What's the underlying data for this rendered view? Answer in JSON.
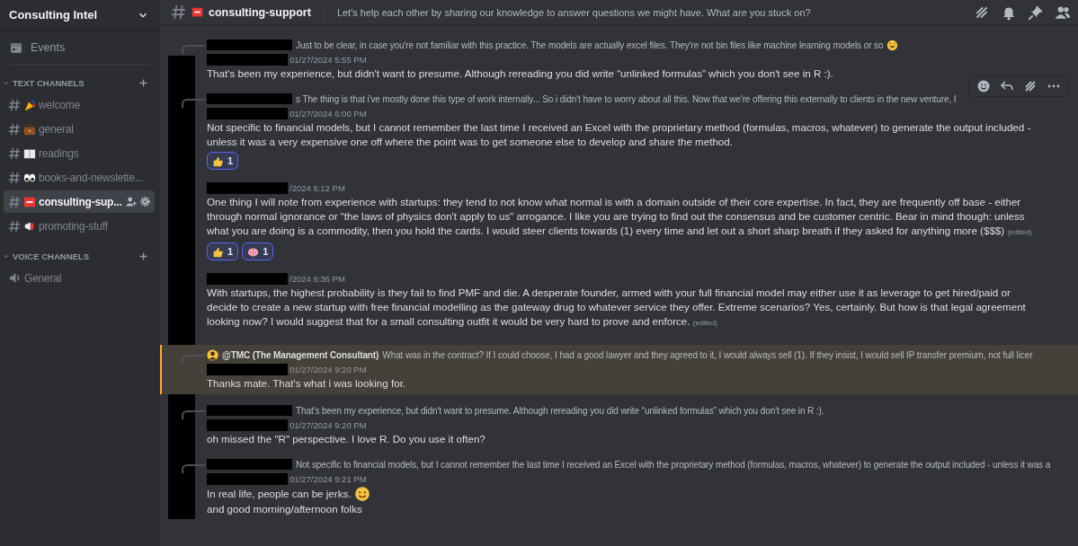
{
  "server": {
    "name": "Consulting Intel"
  },
  "events": {
    "label": "Events"
  },
  "categories": [
    {
      "name": "TEXT CHANNELS",
      "kind": "text",
      "channels": [
        {
          "name": "welcome",
          "selected": false
        },
        {
          "name": "general",
          "selected": false
        },
        {
          "name": "readings",
          "selected": false
        },
        {
          "name": "books-and-newslette...",
          "selected": false
        },
        {
          "name": "consulting-sup...",
          "selected": true
        },
        {
          "name": "promoting-stuff",
          "selected": false
        }
      ]
    },
    {
      "name": "VOICE CHANNELS",
      "kind": "voice",
      "channels": [
        {
          "name": "General",
          "selected": false
        }
      ]
    }
  ],
  "header": {
    "channel": "consulting-support",
    "topic": "Let's help each other by sharing our knowledge to answer questions we might have. What are you stuck on?"
  },
  "messages": [
    {
      "reply": {
        "text": "Just to be clear, in case you're not familiar with this practice. The models are actually excel files. They're not bin files like machine learning models or so",
        "emoji": true
      },
      "timestamp": "01/27/2024 5:55 PM",
      "highlighted": false,
      "hovered": false,
      "lines": [
        {
          "text": "That's been my experience, but didn't want to presume.  Although rereading you did write “unlinked formulas” which you don't see in R :)."
        }
      ]
    },
    {
      "reply": {
        "text": "s The thing is that i've mostly done this type of work internally... So i didn't have to worry about all this. Now that we're offering this externally to clients in the new venture, I"
      },
      "timestamp": "01/27/2024 6:00 PM",
      "highlighted": false,
      "hovered": true,
      "lines": [
        {
          "text": "Not specific to financial models, but I cannot remember the last time I received an Excel with the proprietary method (formulas, macros, whatever) to generate the output included - unless it was a very expensive one off where the point was to get someone else to develop and share the method."
        }
      ],
      "reactions": [
        {
          "count": "1"
        }
      ]
    },
    {
      "timestamp": "/2024 6:12 PM",
      "highlighted": false,
      "hovered": false,
      "lines": [
        {
          "text": "One thing I will note from experience with startups: they tend to not know what normal is with a domain outside of their core expertise.  In fact, they are frequently off base - either through normal ignorance or “the laws of physics don't apply to us” arrogance.  I like you are trying to find out the consensus and be customer centric.  Bear in mind though: unless what you are doing is a commodity, then you hold the cards.  I would steer clients towards (1) every time and let out a short sharp breath if they asked for anything more ($$$)",
          "edited_label": "(edited)"
        }
      ],
      "reactions": [
        {
          "count": "1"
        },
        {
          "count": "1"
        }
      ]
    },
    {
      "timestamp": "/2024 6:36 PM",
      "highlighted": false,
      "hovered": false,
      "lines": [
        {
          "text": "With startups, the highest probability is they fail to find PMF and die.  A desperate founder, armed with your  full financial model may either use it as leverage to get hired/paid or decide to create a new startup with free financial modelling as the gateway drug to whatever service they offer.  Extreme scenarios?  Yes, certainly.  But how is that legal agreement looking now?  I would suggest that for a small consulting outfit it would be very hard to prove and enforce.",
          "edited_label": "(edited)"
        }
      ]
    },
    {
      "reply": {
        "mention": "@TMC (The Management Consultant)",
        "text": "What was in the contract? If I could choose, I had a good lawyer and they agreed to it, I would always sell (1). If they insist, I would sell IP transfer premium, not full licer"
      },
      "timestamp": "01/27/2024 9:20 PM",
      "highlighted": true,
      "hovered": false,
      "lines": [
        {
          "text": "Thanks mate. That's what i was looking for."
        }
      ]
    },
    {
      "reply": {
        "text": "That's been my experience, but didn't want to presume. Although rereading you did write “unlinked formulas” which you don't see in R :)."
      },
      "timestamp": "01/27/2024 9:20 PM",
      "highlighted": false,
      "hovered": false,
      "lines": [
        {
          "text": "oh missed the \"R\" perspective. I love R. Do you use it often?"
        }
      ]
    },
    {
      "reply": {
        "text": "Not specific to financial models, but I cannot remember the last time I received an Excel with the proprietary method (formulas, macros, whatever) to generate the output included - unless it was a"
      },
      "timestamp": "01/27/2024 9:21 PM",
      "highlighted": false,
      "hovered": false,
      "lines": [
        {
          "text": "In real life, people can be jerks.",
          "emoji": true
        },
        {
          "text": "and good morning/afternoon folks"
        }
      ]
    }
  ]
}
